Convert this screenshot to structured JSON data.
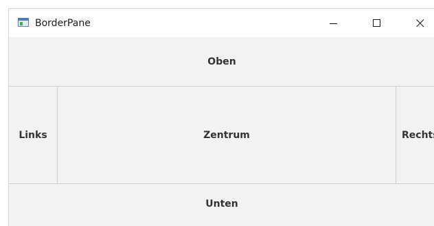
{
  "window": {
    "title": "BorderPane",
    "icon": "app-window-icon",
    "controls": {
      "minimize_icon": "minimize-icon",
      "maximize_icon": "maximize-icon",
      "close_icon": "close-icon"
    }
  },
  "border_pane": {
    "top": "Oben",
    "left": "Links",
    "center": "Zentrum",
    "right": "Rechts",
    "bottom": "Unten"
  },
  "colors": {
    "content_background": "#f2f2f2",
    "titlebar_background": "#ffffff",
    "divider": "#cfcfcf",
    "label_text": "#333333"
  }
}
